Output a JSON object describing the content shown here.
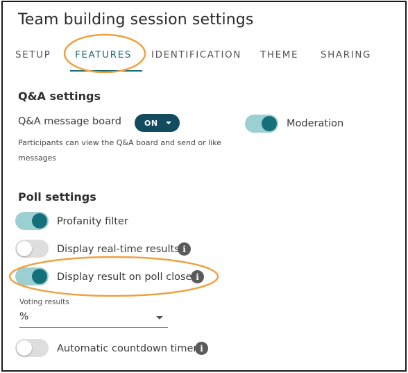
{
  "title": "Team building session settings",
  "tabs": [
    {
      "label": "SETUP"
    },
    {
      "label": "FEATURES"
    },
    {
      "label": "IDENTIFICATION"
    },
    {
      "label": "THEME"
    },
    {
      "label": "SHARING"
    }
  ],
  "active_tab": "FEATURES",
  "qa": {
    "heading": "Q&A settings",
    "message_board_label": "Q&A message board",
    "message_board_value": "ON",
    "message_board_helper": "Participants can view the Q&A board and send or like messages",
    "moderation_label": "Moderation",
    "moderation_on": true
  },
  "poll": {
    "heading": "Poll settings",
    "profanity_label": "Profanity filter",
    "profanity_on": true,
    "realtime_label": "Display real-time results",
    "realtime_on": false,
    "on_close_label": "Display result on poll close",
    "on_close_on": true,
    "voting_results_label": "Voting results",
    "voting_results_value": "%",
    "countdown_label": "Automatic countdown timer",
    "countdown_on": false
  },
  "info_glyph": "i",
  "colors": {
    "accent": "#1b6a74",
    "toggle_track_on": "#9ccfd2",
    "toggle_knob_on": "#14707a",
    "button_dark": "#134b61",
    "annotation": "#f0a040"
  },
  "icons": {
    "info": "info-icon",
    "dropdown": "chevron-down-icon"
  }
}
